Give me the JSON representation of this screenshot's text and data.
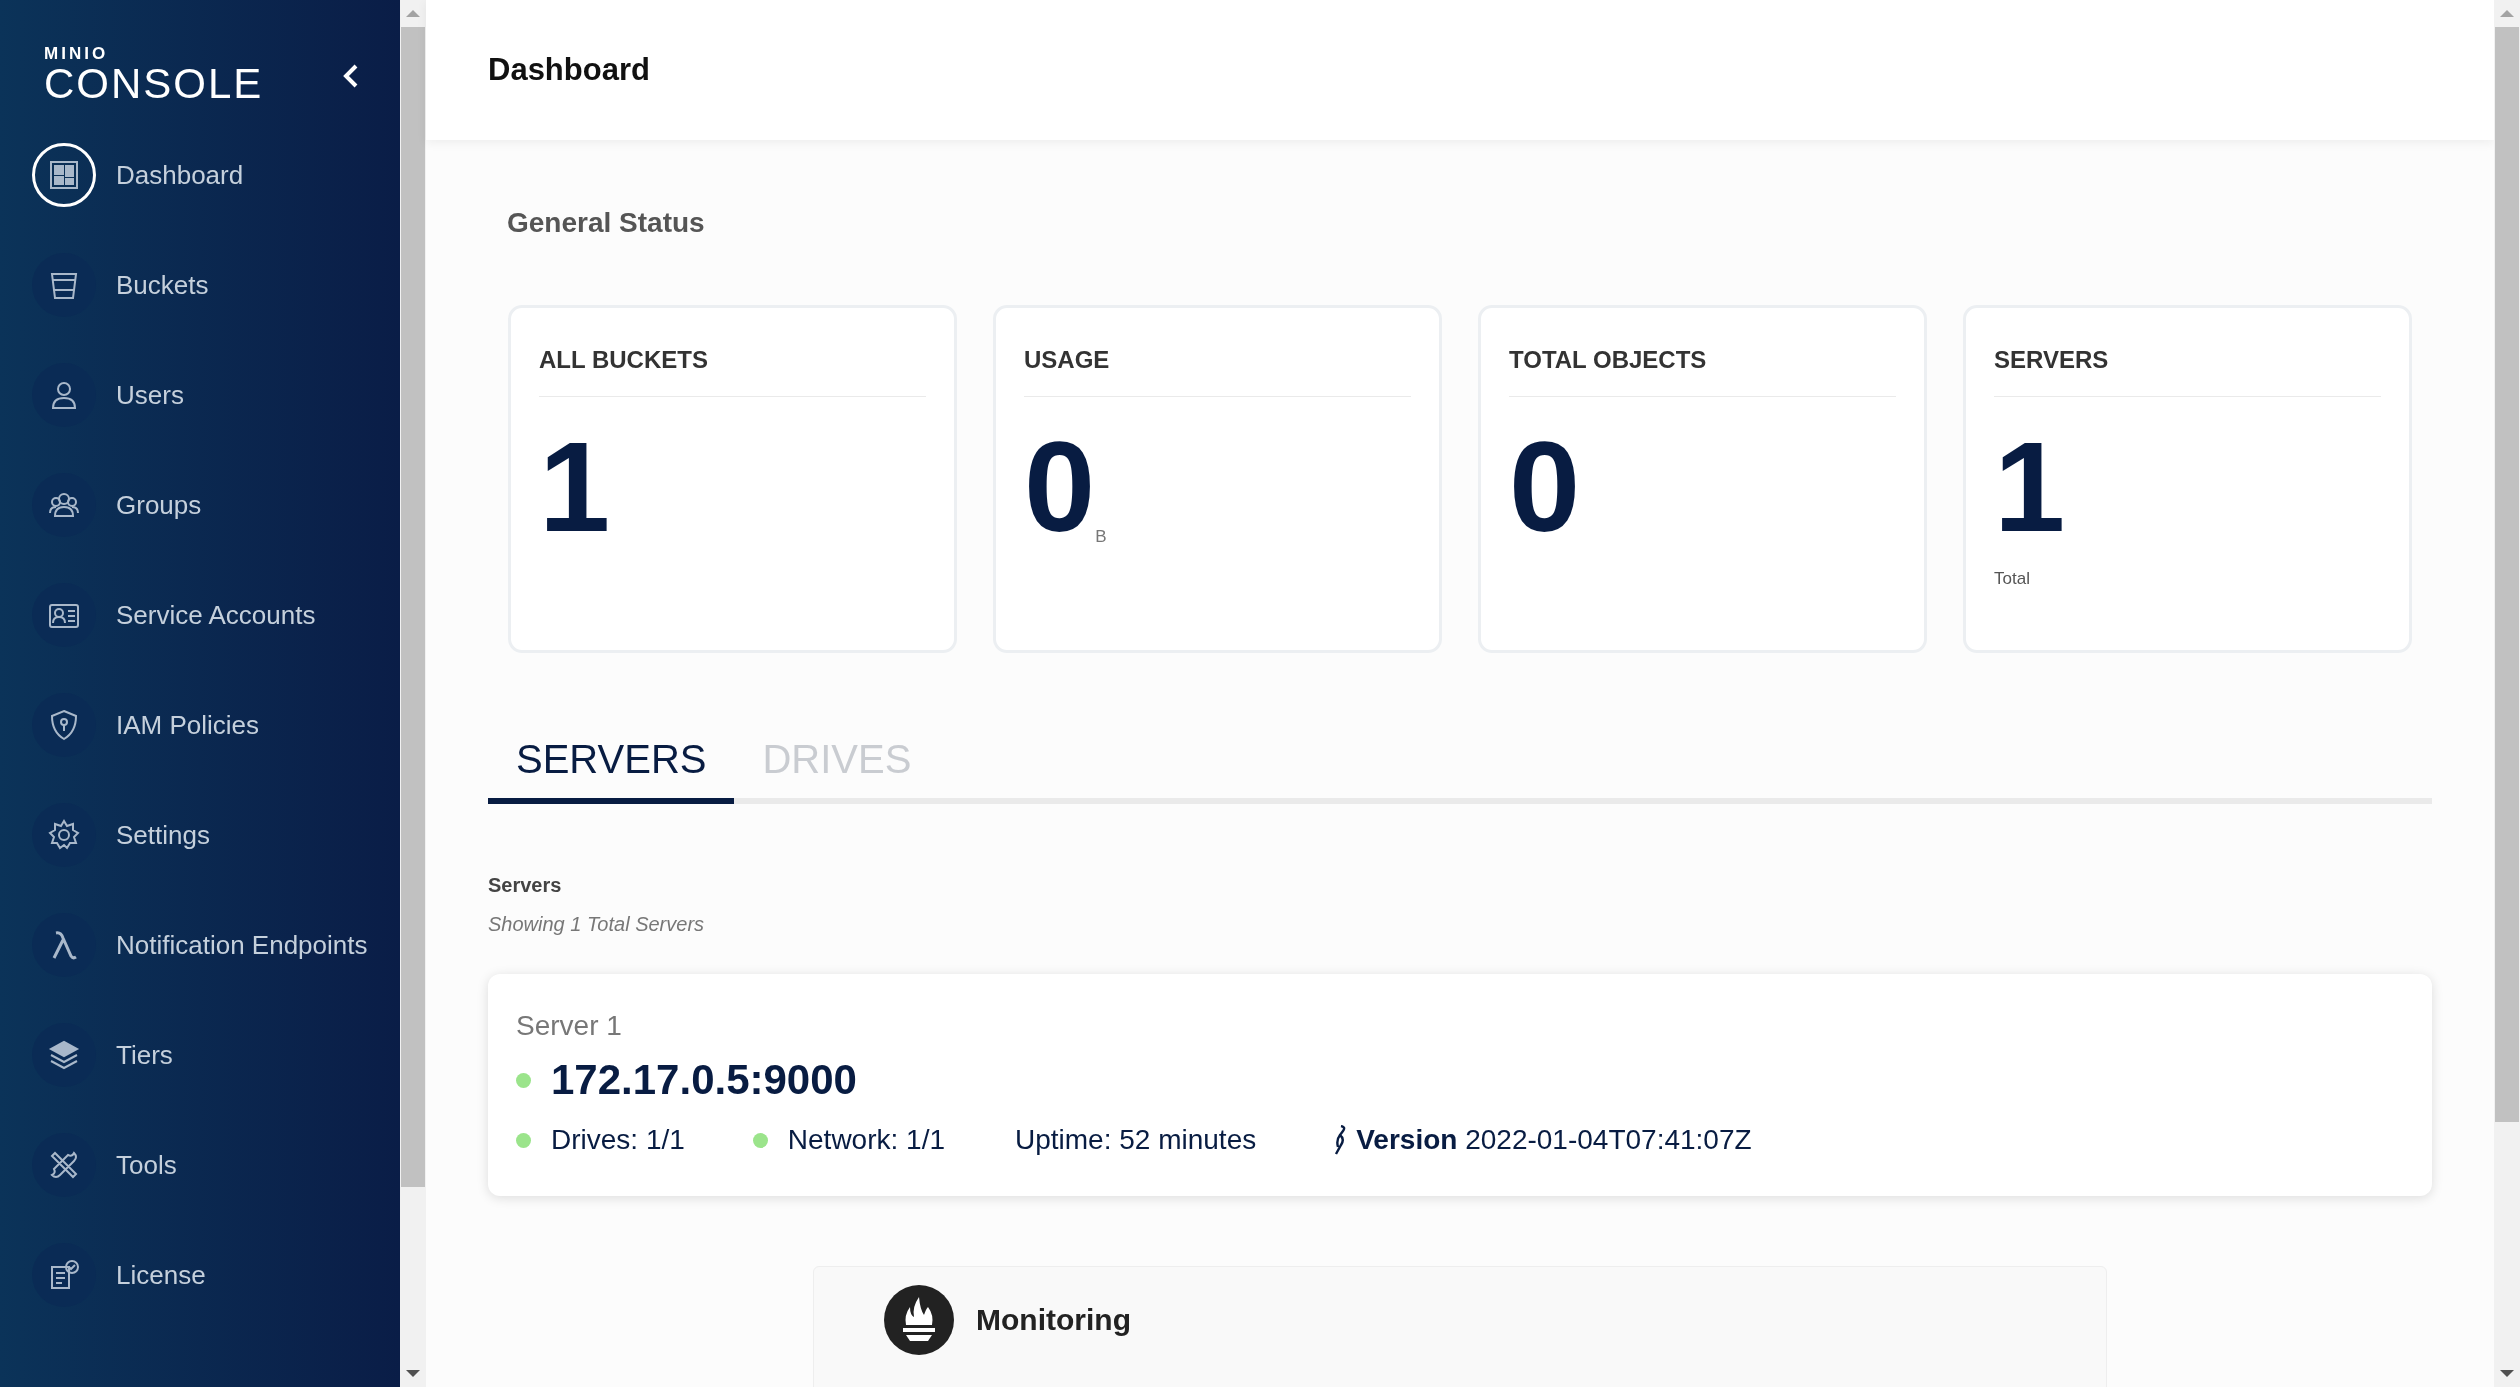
{
  "sidebar": {
    "logo_top": "MINIO",
    "logo": "CONSOLE",
    "items": [
      {
        "label": "Dashboard",
        "selected": true
      },
      {
        "label": "Buckets",
        "selected": false
      },
      {
        "label": "Users",
        "selected": false
      },
      {
        "label": "Groups",
        "selected": false
      },
      {
        "label": "Service Accounts",
        "selected": false
      },
      {
        "label": "IAM Policies",
        "selected": false
      },
      {
        "label": "Settings",
        "selected": false
      },
      {
        "label": "Notification Endpoints",
        "selected": false
      },
      {
        "label": "Tiers",
        "selected": false
      },
      {
        "label": "Tools",
        "selected": false
      },
      {
        "label": "License",
        "selected": false
      }
    ]
  },
  "header": {
    "title": "Dashboard"
  },
  "section_title": "General Status",
  "cards": [
    {
      "title": "ALL BUCKETS",
      "value": "1"
    },
    {
      "title": "USAGE",
      "value": "0",
      "unit": "B"
    },
    {
      "title": "TOTAL OBJECTS",
      "value": "0"
    },
    {
      "title": "SERVERS",
      "value": "1",
      "caption": "Total"
    }
  ],
  "tabs": [
    {
      "label": "SERVERS",
      "selected": true
    },
    {
      "label": "DRIVES",
      "selected": false
    }
  ],
  "servers": {
    "title": "Servers",
    "subtitle": "Showing 1 Total Servers",
    "items": [
      {
        "name": "Server 1",
        "endpoint": "172.17.0.5:9000",
        "online": true,
        "drives": "Drives: 1/1",
        "drives_ok": true,
        "network": "Network: 1/1",
        "network_ok": true,
        "uptime": "Uptime: 52 minutes",
        "version_label": "Version",
        "version": "2022-01-04T07:41:07Z"
      }
    ]
  },
  "monitoring": {
    "title": "Monitoring"
  }
}
